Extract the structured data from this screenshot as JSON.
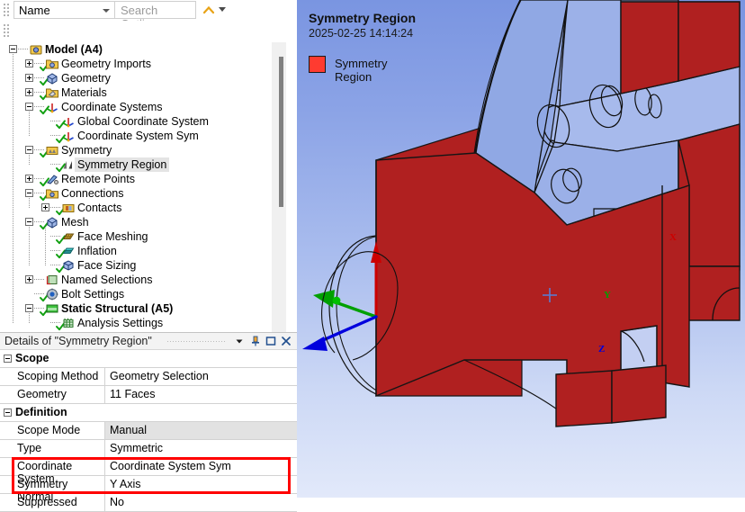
{
  "outline_toolbar": {
    "filter_combo": {
      "value": "Name",
      "icon": "chevron-down-icon"
    },
    "search_input": {
      "placeholder": "Search Outline",
      "value": ""
    },
    "collapse_chevron_icon": "chevron-up-icon",
    "overflow_icon": "overflow-arrow-icon",
    "buttons": [
      {
        "name": "refresh-button",
        "icon": "refresh-icon"
      },
      {
        "name": "clear-generated-data-button",
        "icon": "eraser-icon"
      },
      {
        "name": "expand-collapse-button",
        "icon": "sort-updown-icon"
      },
      {
        "name": "expand-all-button",
        "icon": "plus-box-icon"
      },
      {
        "name": "show-hidden-button",
        "icon": "folder-eye-icon"
      },
      {
        "name": "sort-alpha-button",
        "icon": "sort-az-icon"
      }
    ]
  },
  "tree": {
    "items": [
      {
        "label": "Model (A4)",
        "depth": 0,
        "expander": "minus",
        "icon": "model-icon",
        "bold": true,
        "check": false,
        "selected": false
      },
      {
        "label": "Geometry Imports",
        "depth": 1,
        "expander": "plus",
        "icon": "geometry-imports-icon",
        "bold": false,
        "check": true,
        "selected": false
      },
      {
        "label": "Geometry",
        "depth": 1,
        "expander": "plus",
        "icon": "geometry-icon",
        "bold": false,
        "check": true,
        "selected": false
      },
      {
        "label": "Materials",
        "depth": 1,
        "expander": "plus",
        "icon": "materials-icon",
        "bold": false,
        "check": true,
        "selected": false
      },
      {
        "label": "Coordinate Systems",
        "depth": 1,
        "expander": "minus",
        "icon": "coordinate-systems-icon",
        "bold": false,
        "check": true,
        "selected": false
      },
      {
        "label": "Global Coordinate System",
        "depth": 2,
        "expander": "none",
        "icon": "coordinate-system-icon",
        "bold": false,
        "check": true,
        "selected": false
      },
      {
        "label": "Coordinate System Sym",
        "depth": 2,
        "expander": "none",
        "icon": "coordinate-system-icon",
        "bold": false,
        "check": true,
        "selected": false
      },
      {
        "label": "Symmetry",
        "depth": 1,
        "expander": "minus",
        "icon": "symmetry-icon",
        "bold": false,
        "check": true,
        "selected": false
      },
      {
        "label": "Symmetry Region",
        "depth": 2,
        "expander": "none",
        "icon": "symmetry-region-icon",
        "bold": false,
        "check": true,
        "selected": true
      },
      {
        "label": "Remote Points",
        "depth": 1,
        "expander": "plus",
        "icon": "remote-points-icon",
        "bold": false,
        "check": true,
        "selected": false
      },
      {
        "label": "Connections",
        "depth": 1,
        "expander": "minus",
        "icon": "connections-icon",
        "bold": false,
        "check": true,
        "selected": false
      },
      {
        "label": "Contacts",
        "depth": 2,
        "expander": "plus",
        "icon": "contacts-icon",
        "bold": false,
        "check": true,
        "selected": false
      },
      {
        "label": "Mesh",
        "depth": 1,
        "expander": "minus",
        "icon": "mesh-icon",
        "bold": false,
        "check": true,
        "selected": false
      },
      {
        "label": "Face Meshing",
        "depth": 2,
        "expander": "none",
        "icon": "face-meshing-icon",
        "bold": false,
        "check": true,
        "selected": false
      },
      {
        "label": "Inflation",
        "depth": 2,
        "expander": "none",
        "icon": "inflation-icon",
        "bold": false,
        "check": true,
        "selected": false
      },
      {
        "label": "Face Sizing",
        "depth": 2,
        "expander": "none",
        "icon": "face-sizing-icon",
        "bold": false,
        "check": true,
        "selected": false
      },
      {
        "label": "Named Selections",
        "depth": 1,
        "expander": "plus",
        "icon": "named-selections-icon",
        "bold": false,
        "check": false,
        "selected": false
      },
      {
        "label": "Bolt Settings",
        "depth": 1,
        "expander": "none",
        "icon": "bolt-settings-icon",
        "bold": false,
        "check": true,
        "selected": false
      },
      {
        "label": "Static Structural (A5)",
        "depth": 1,
        "expander": "minus",
        "icon": "static-structural-icon",
        "bold": true,
        "check": true,
        "selected": false
      },
      {
        "label": "Analysis Settings",
        "depth": 2,
        "expander": "none",
        "icon": "analysis-settings-icon",
        "bold": false,
        "check": true,
        "selected": false
      }
    ]
  },
  "details": {
    "title": "Details of \"Symmetry Region\"",
    "window_buttons": [
      {
        "name": "details-menu-button",
        "icon": "chevron-down-icon"
      },
      {
        "name": "details-pin-button",
        "icon": "pin-icon"
      },
      {
        "name": "details-maximize-button",
        "icon": "maximize-icon"
      },
      {
        "name": "details-close-button",
        "icon": "close-icon"
      }
    ],
    "rows": [
      {
        "kind": "header",
        "label": "Scope"
      },
      {
        "kind": "field",
        "label": "Scoping Method",
        "value": "Geometry Selection",
        "readonly": false,
        "highlighted": false
      },
      {
        "kind": "field",
        "label": "Geometry",
        "value": "11 Faces",
        "readonly": false,
        "highlighted": false
      },
      {
        "kind": "header",
        "label": "Definition"
      },
      {
        "kind": "field",
        "label": "Scope Mode",
        "value": "Manual",
        "readonly": true,
        "highlighted": false
      },
      {
        "kind": "field",
        "label": "Type",
        "value": "Symmetric",
        "readonly": false,
        "highlighted": false
      },
      {
        "kind": "field",
        "label": "Coordinate System",
        "value": "Coordinate System Sym",
        "readonly": false,
        "highlighted": true
      },
      {
        "kind": "field",
        "label": "Symmetry Normal",
        "value": "Y Axis",
        "readonly": false,
        "highlighted": true
      },
      {
        "kind": "field",
        "label": "Suppressed",
        "value": "No",
        "readonly": false,
        "highlighted": false
      }
    ],
    "highlight_color": "#ff0000"
  },
  "viewport": {
    "title": "Symmetry Region",
    "date": "2025-02-25  14:14:24",
    "legend": [
      {
        "label": "Symmetry Region",
        "color": "#ff3b30"
      }
    ],
    "triad": [
      {
        "axis": "X",
        "color": "#cc0000"
      },
      {
        "axis": "Y",
        "color": "#00aa00"
      },
      {
        "axis": "Z",
        "color": "#0000dd"
      }
    ],
    "colors": {
      "highlight_face": "#b02020",
      "body": "#8aa3e0",
      "background_top": "#7a95e1",
      "background_bottom": "#e2e9fa"
    },
    "rotation_center_marker": "crosshair-icon"
  }
}
